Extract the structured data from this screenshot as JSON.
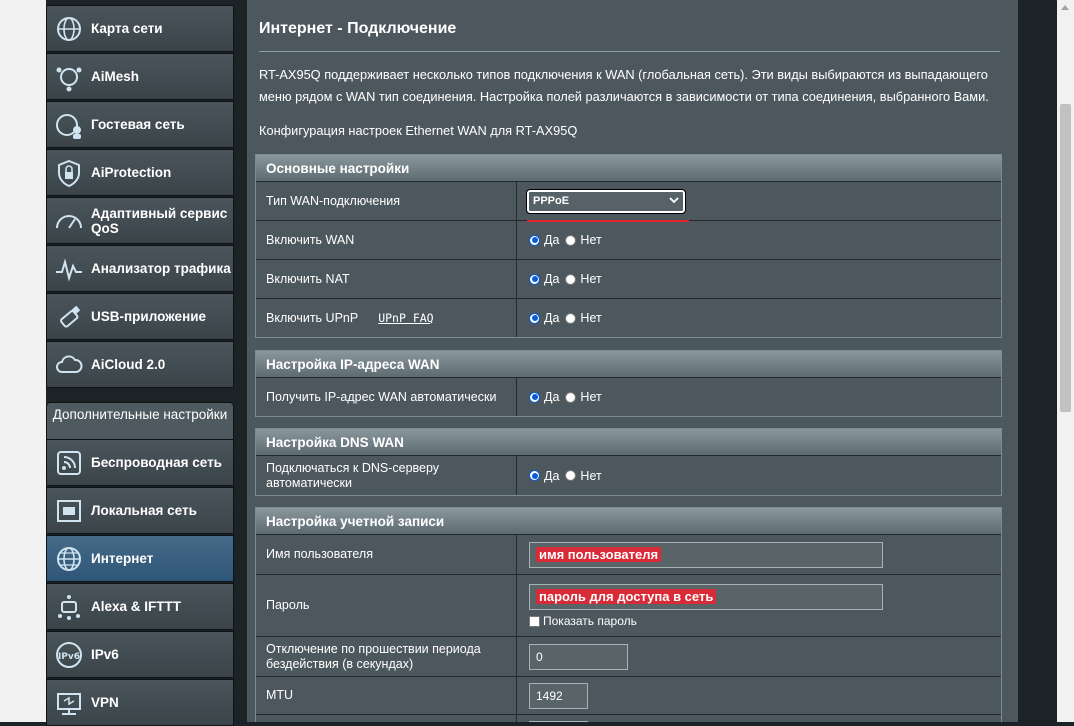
{
  "sidebar": {
    "items": [
      {
        "label": "Карта сети",
        "icon": "network-map-icon"
      },
      {
        "label": "AiMesh",
        "icon": "aimesh-icon"
      },
      {
        "label": "Гостевая сеть",
        "icon": "guest-network-icon"
      },
      {
        "label": "AiProtection",
        "icon": "aiprotection-lock-icon"
      },
      {
        "label": "Адаптивный сервис QoS",
        "icon": "qos-gauge-icon"
      },
      {
        "label": "Анализатор трафика",
        "icon": "traffic-analyzer-icon"
      },
      {
        "label": "USB-приложение",
        "icon": "usb-icon"
      },
      {
        "label": "AiCloud 2.0",
        "icon": "aicloud-icon"
      }
    ],
    "advanced_header": "Дополнительные настройки",
    "advanced_items": [
      {
        "label": "Беспроводная сеть",
        "icon": "wireless-icon"
      },
      {
        "label": "Локальная сеть",
        "icon": "lan-icon"
      },
      {
        "label": "Интернет",
        "icon": "internet-globe-icon",
        "active": true
      },
      {
        "label": "Alexa & IFTTT",
        "icon": "alexa-ifttt-icon"
      },
      {
        "label": "IPv6",
        "icon": "ipv6-icon"
      },
      {
        "label": "VPN",
        "icon": "vpn-icon"
      }
    ]
  },
  "main": {
    "title": "Интернет - Подключение",
    "description": "RT-AX95Q поддерживает несколько типов подключения к WAN (глобальная сеть). Эти виды выбираются из выпадающего меню рядом с WAN тип соединения. Настройка полей различаются в зависимости от типа соединения, выбранного Вами.",
    "config_note": "Конфигурация настроек Ethernet WAN для RT-AX95Q",
    "yes": "Да",
    "no": "Нет",
    "basic": {
      "header": "Основные настройки",
      "wan_type_label": "Тип WAN-подключения",
      "wan_type_value": "PPPoE",
      "enable_wan_label": "Включить WAN",
      "enable_nat_label": "Включить NAT",
      "enable_upnp_label": "Включить UPnP",
      "upnp_faq": "UPnP FAQ"
    },
    "wan_ip": {
      "header": "Настройка IP-адреса WAN",
      "auto_ip_label": "Получить IP-адрес WAN автоматически"
    },
    "dns": {
      "header": "Настройка DNS WAN",
      "auto_dns_label": "Подключаться к DNS-серверу автоматически"
    },
    "account": {
      "header": "Настройка учетной записи",
      "username_label": "Имя пользователя",
      "username_value": "имя пользователя",
      "password_label": "Пароль",
      "password_value": "пароль для доступа в сеть",
      "show_password_label": "Показать пароль",
      "idle_label": "Отключение по прошествии периода бездействия (в секундах)",
      "idle_value": "0",
      "mtu_label": "MTU",
      "mtu_value": "1492"
    }
  },
  "colors": {
    "accent_red": "#e0242e",
    "active_tab": "#2f5677",
    "panel_bg": "#4d585e"
  }
}
